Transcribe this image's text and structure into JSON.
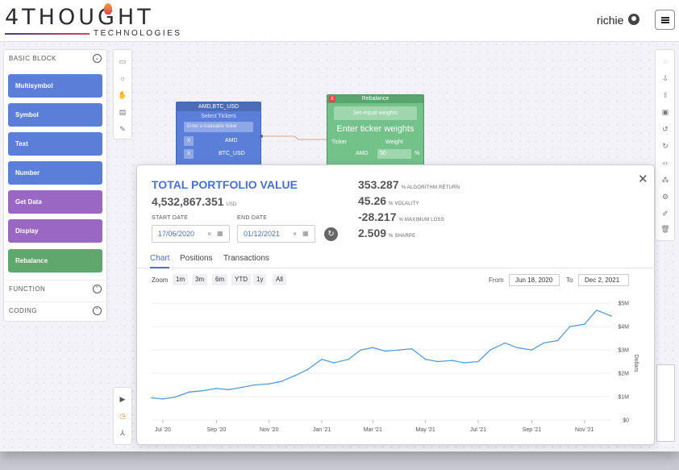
{
  "header": {
    "logo_main": "4THOUGHT",
    "logo_sub": "TECHNOLOGIES",
    "user": "richie"
  },
  "sidebar": {
    "basic_block": "BASIC BLOCK",
    "items": [
      {
        "label": "Multisymbol",
        "color": "blue"
      },
      {
        "label": "Symbol",
        "color": "blue"
      },
      {
        "label": "Text",
        "color": "blue"
      },
      {
        "label": "Number",
        "color": "blue"
      },
      {
        "label": "Get Data",
        "color": "purple"
      },
      {
        "label": "Display",
        "color": "purple"
      },
      {
        "label": "Rebalance",
        "color": "green"
      }
    ],
    "function": "FUNCTION",
    "coding": "CODING"
  },
  "node_tickers": {
    "title": "AMD,BTC_USD",
    "subtitle": "Select Tickers",
    "placeholder": "Enter a tradeable ticker",
    "rows": [
      "AMD",
      "BTC_USD"
    ],
    "remove": "X"
  },
  "node_rebalance": {
    "title": "Rebalance",
    "close": "X",
    "button": "Set equal weights",
    "heading": "Enter ticker weights",
    "col_ticker": "Ticker",
    "col_weight": "Weight",
    "row_ticker": "AMD",
    "row_weight": "50",
    "row_unit": "%"
  },
  "modal": {
    "title": "TOTAL PORTFOLIO VALUE",
    "value": "4,532,867.351",
    "value_unit": "USD",
    "start_label": "START DATE",
    "start_value": "17/06/2020",
    "end_label": "END DATE",
    "end_value": "01/12/2021",
    "stats": [
      {
        "value": "353.287",
        "label": "% ALGORITHM RETURN"
      },
      {
        "value": "45.26",
        "label": "% VOLALITY"
      },
      {
        "value": "-28.217",
        "label": "% MAXIMUM LOSS"
      },
      {
        "value": "2.509",
        "label": "% SHARPE"
      }
    ],
    "tabs": [
      "Chart",
      "Positions",
      "Transactions"
    ],
    "zoom_label": "Zoom",
    "zoom_buttons": [
      "1m",
      "3m",
      "6m",
      "YTD",
      "1y",
      "All"
    ],
    "from_label": "From",
    "from_value": "Jun 18, 2020",
    "to_label": "To",
    "to_value": "Dec 2, 2021"
  },
  "chart_data": {
    "type": "line",
    "title": "",
    "xlabel": "",
    "ylabel": "Dollars",
    "x_ticks": [
      "Jul '20",
      "Sep '20",
      "Nov '20",
      "Jan '21",
      "Mar '21",
      "May '21",
      "Jul '21",
      "Sep '21",
      "Nov '21"
    ],
    "y_ticks": [
      "$0",
      "$1M",
      "$2M",
      "$3M",
      "$4M",
      "$5M"
    ],
    "ylim": [
      0,
      5000000
    ],
    "color": "#5b9bd5",
    "x": [
      "Jun 18, 2020",
      "Jul 1, 2020",
      "Jul 15, 2020",
      "Aug 1, 2020",
      "Aug 15, 2020",
      "Sep 1, 2020",
      "Sep 15, 2020",
      "Oct 1, 2020",
      "Oct 15, 2020",
      "Nov 1, 2020",
      "Nov 15, 2020",
      "Dec 1, 2020",
      "Dec 15, 2020",
      "Jan 1, 2021",
      "Jan 15, 2021",
      "Feb 1, 2021",
      "Feb 15, 2021",
      "Mar 1, 2021",
      "Mar 15, 2021",
      "Apr 1, 2021",
      "Apr 15, 2021",
      "May 1, 2021",
      "May 15, 2021",
      "Jun 1, 2021",
      "Jun 15, 2021",
      "Jul 1, 2021",
      "Jul 15, 2021",
      "Aug 1, 2021",
      "Aug 15, 2021",
      "Sep 1, 2021",
      "Sep 15, 2021",
      "Oct 1, 2021",
      "Oct 15, 2021",
      "Nov 1, 2021",
      "Nov 15, 2021",
      "Dec 2, 2021"
    ],
    "values": [
      950000,
      900000,
      980000,
      1200000,
      1250000,
      1350000,
      1300000,
      1400000,
      1500000,
      1550000,
      1650000,
      1900000,
      2150000,
      2600000,
      2450000,
      2600000,
      3000000,
      3100000,
      2950000,
      3000000,
      3050000,
      2600000,
      2500000,
      2550000,
      2450000,
      2500000,
      3000000,
      3300000,
      3100000,
      3000000,
      3300000,
      3400000,
      4000000,
      4100000,
      4700000,
      4450000
    ]
  }
}
